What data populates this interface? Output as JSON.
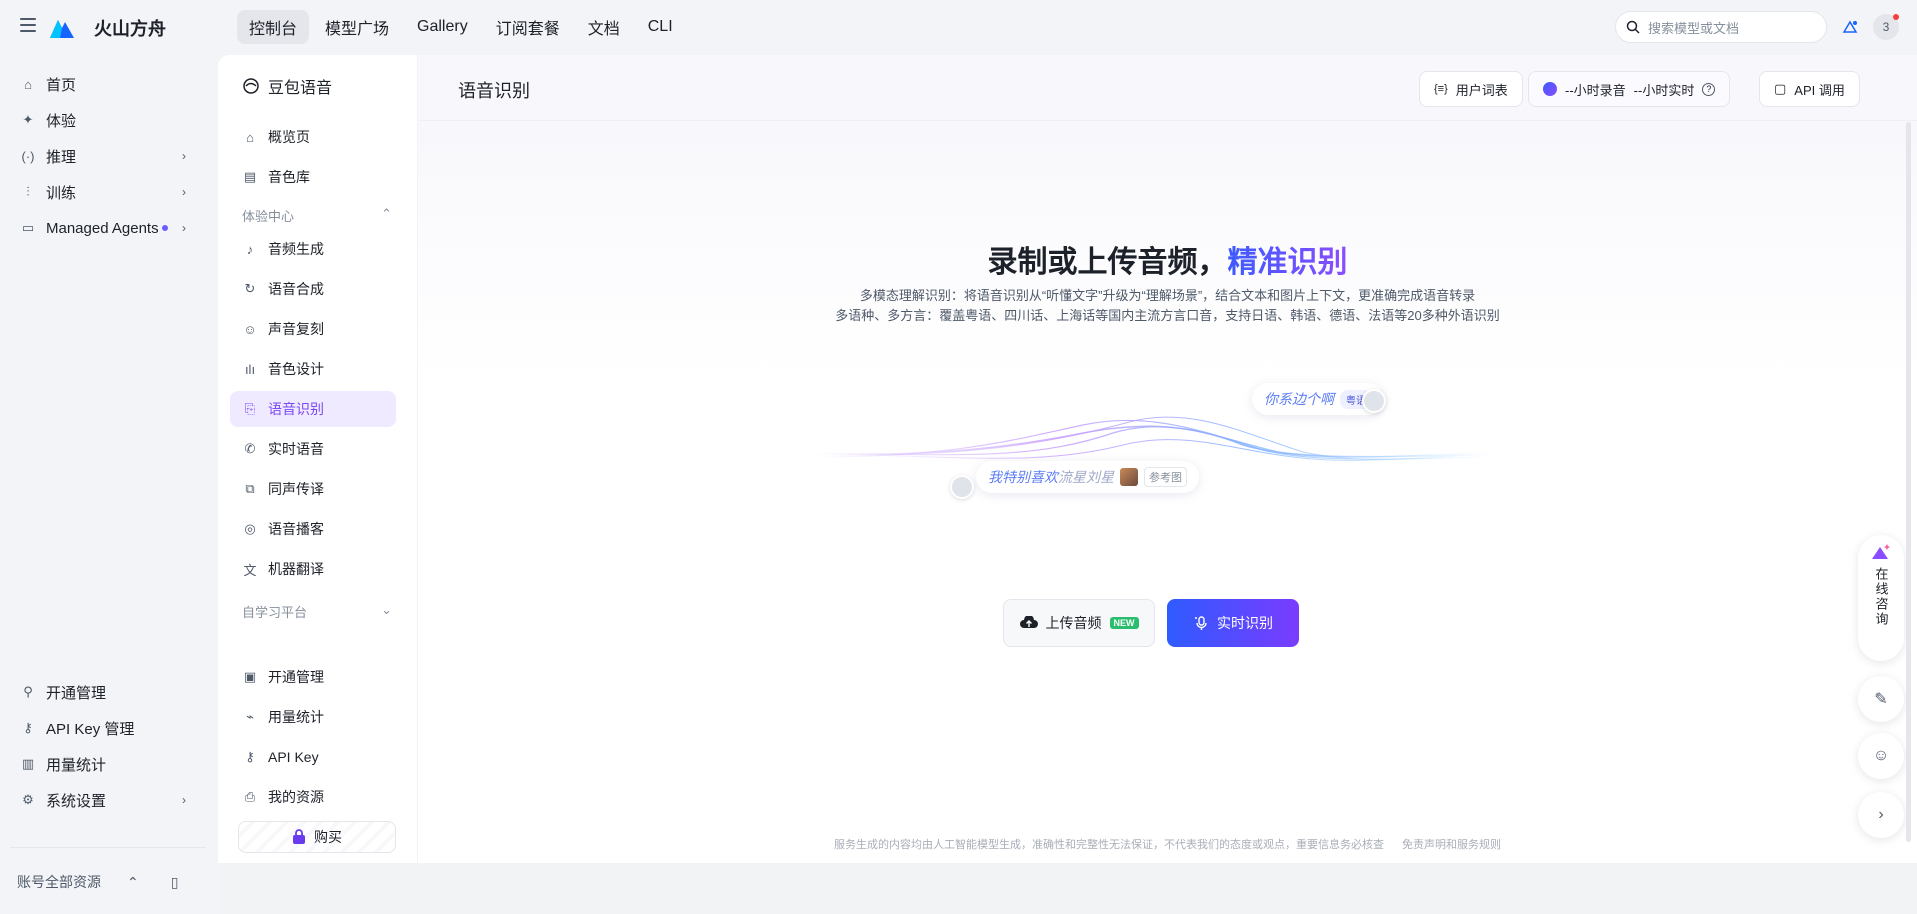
{
  "app": {
    "brand": "火山方舟"
  },
  "top_nav": {
    "tabs": [
      {
        "label": "控制台",
        "active": true
      },
      {
        "label": "模型广场"
      },
      {
        "label": "Gallery"
      },
      {
        "label": "订阅套餐"
      },
      {
        "label": "文档"
      },
      {
        "label": "CLI"
      }
    ],
    "search_placeholder": "搜索模型或文档",
    "notification_count": "3"
  },
  "left_nav": {
    "items": [
      {
        "label": "首页",
        "icon": "home-icon"
      },
      {
        "label": "体验",
        "icon": "sparkle-icon"
      },
      {
        "label": "推理",
        "icon": "inference-icon"
      },
      {
        "label": "训练",
        "icon": "sliders-icon"
      },
      {
        "label": "Managed Agents",
        "icon": "monitor-icon"
      }
    ],
    "bottom_items": [
      {
        "label": "开通管理",
        "icon": "user-icon"
      },
      {
        "label": "API Key 管理",
        "icon": "key-icon"
      },
      {
        "label": "用量统计",
        "icon": "bar-chart-icon"
      },
      {
        "label": "系统设置",
        "icon": "gear-icon"
      }
    ],
    "account": "账号全部资源"
  },
  "sub_nav": {
    "title": "豆包语音",
    "items_top": [
      {
        "label": "概览页",
        "icon": "overview-icon"
      },
      {
        "label": "音色库",
        "icon": "library-icon"
      }
    ],
    "group_experience": "体验中心",
    "experience_items": [
      {
        "label": "音频生成",
        "icon": "audio-gen-icon"
      },
      {
        "label": "语音合成",
        "icon": "tts-icon"
      },
      {
        "label": "声音复刻",
        "icon": "voice-clone-icon"
      },
      {
        "label": "音色设计",
        "icon": "waveform-icon"
      },
      {
        "label": "语音识别",
        "icon": "asr-icon",
        "active": true
      },
      {
        "label": "实时语音",
        "icon": "phone-icon"
      },
      {
        "label": "同声传译",
        "icon": "interpret-icon"
      },
      {
        "label": "语音播客",
        "icon": "podcast-icon"
      },
      {
        "label": "机器翻译",
        "icon": "translate-icon"
      }
    ],
    "group_selflearn": "自学习平台",
    "manage_items": [
      {
        "label": "开通管理",
        "icon": "doc-icon"
      },
      {
        "label": "用量统计",
        "icon": "chart-icon"
      },
      {
        "label": "API Key",
        "icon": "key-icon"
      },
      {
        "label": "我的资源",
        "icon": "bag-icon"
      }
    ],
    "buy_label": "购买"
  },
  "content": {
    "page_title": "语音识别",
    "header_buttons": {
      "dictionary": "用户词表",
      "hours_record": "--小时录音",
      "hours_realtime": "--小时实时",
      "api_call": "API 调用"
    },
    "hero_title_main": "录制或上传音频，",
    "hero_title_accent": "精准识别",
    "hero_line1": "多模态理解识别：将语音识别从“听懂文字”升级为“理解场景”，结合文本和图片上下文，更准确完成语音转录",
    "hero_line2": "多语种、多方言：覆盖粤语、四川话、上海话等国内主流方言口音，支持日语、韩语、德语、法语等20多种外语识别",
    "bubble_right_text": "你系边个啊",
    "bubble_right_tag": "粤语",
    "bubble_left_text_a": "我特别喜欢",
    "bubble_left_text_b": "流星刘星",
    "bubble_left_tag": "参考图",
    "upload_label": "上传音频",
    "upload_badge": "NEW",
    "live_label": "实时识别",
    "disclaimer": "服务生成的内容均由人工智能模型生成，准确性和完整性无法保证，不代表我们的态度或观点，重要信息务必核查",
    "disclaimer_link": "免责声明和服务规则"
  },
  "floating": {
    "consult_label": "在线咨询"
  },
  "colors": {
    "accent": "#7b49f6",
    "primary_blue": "#2e5bff"
  }
}
